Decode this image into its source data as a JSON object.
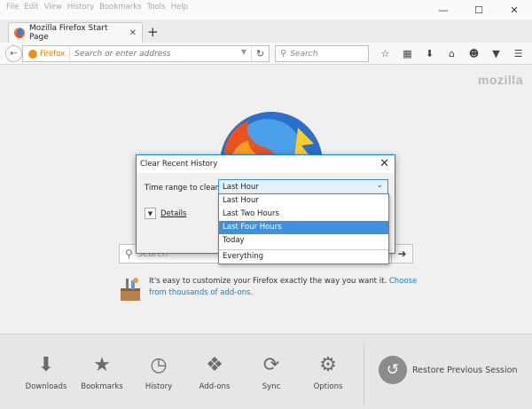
{
  "menu": [
    "File",
    "Edit",
    "View",
    "History",
    "Bookmarks",
    "Tools",
    "Help"
  ],
  "window_controls": {
    "minimize": "—",
    "maximize": "☐",
    "close": "✕"
  },
  "tab": {
    "title": "Mozilla Firefox Start Page",
    "close": "✕",
    "new_tab": "+"
  },
  "nav": {
    "identity_label": "Firefox",
    "url_placeholder": "Search or enter address",
    "search_placeholder": "Search"
  },
  "toolbar_icons": [
    "star-icon",
    "reading-list-icon",
    "download-icon",
    "home-icon",
    "smiley-icon",
    "pocket-icon",
    "hamburger-menu-icon"
  ],
  "content": {
    "brand": "mozilla",
    "search_placeholder": "Search",
    "addon_text": "It's easy to customize your Firefox exactly the way you want it. ",
    "addon_link": "Choose from thousands of add-ons",
    "addon_end": "."
  },
  "launcher": {
    "items": [
      {
        "label": "Downloads",
        "icon": "download-icon"
      },
      {
        "label": "Bookmarks",
        "icon": "star-icon"
      },
      {
        "label": "History",
        "icon": "clock-icon"
      },
      {
        "label": "Add-ons",
        "icon": "puzzle-icon"
      },
      {
        "label": "Sync",
        "icon": "sync-icon"
      },
      {
        "label": "Options",
        "icon": "gear-icon"
      }
    ],
    "restore_label": "Restore Previous Session"
  },
  "dialog": {
    "title": "Clear Recent History",
    "close": "✕",
    "time_range_label": "Time range to clear:",
    "time_range_value": "Last Hour",
    "details_label": "Details",
    "options": [
      "Last Hour",
      "Last Two Hours",
      "Last Four Hours",
      "Today",
      "Everything"
    ],
    "highlighted_option": "Last Four Hours"
  },
  "colors": {
    "accent": "#3f91dd",
    "link": "#0a84cc",
    "dialog_border": "#1883d7"
  }
}
